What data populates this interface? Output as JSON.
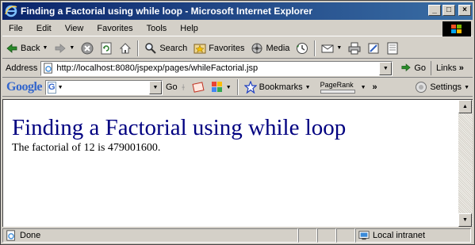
{
  "window": {
    "title": "Finding a Factorial using while loop - Microsoft Internet Explorer",
    "controls": {
      "minimize": "_",
      "maximize": "□",
      "close": "×"
    }
  },
  "menu": {
    "items": [
      "File",
      "Edit",
      "View",
      "Favorites",
      "Tools",
      "Help"
    ]
  },
  "toolbar": {
    "back_label": "Back",
    "search_label": "Search",
    "favorites_label": "Favorites",
    "media_label": "Media"
  },
  "address": {
    "label": "Address",
    "url": "http://localhost:8080/jspexp/pages/whileFactorial.jsp",
    "go_label": "Go",
    "links_label": "Links"
  },
  "google_toolbar": {
    "logo": "Google",
    "search_icon_letter": "G",
    "query": "",
    "go_label": "Go",
    "bookmarks_label": "Bookmarks",
    "pagerank_label": "PageRank",
    "settings_label": "Settings"
  },
  "page": {
    "heading": "Finding a Factorial using while loop",
    "result_text": "The factorial of 12 is 479001600."
  },
  "status": {
    "text": "Done",
    "zone": "Local intranet"
  },
  "colors": {
    "titlebar_start": "#0a246a",
    "titlebar_end": "#3a6ea5",
    "heading": "#000080",
    "chrome": "#d4d0c8"
  },
  "icons": [
    "ie-logo-icon",
    "windows-logo-icon",
    "back-arrow-icon",
    "forward-arrow-icon",
    "stop-icon",
    "refresh-icon",
    "home-icon",
    "search-icon",
    "favorites-icon",
    "media-icon",
    "history-icon",
    "mail-icon",
    "print-icon",
    "edit-icon",
    "discuss-icon",
    "page-icon",
    "go-arrow-icon",
    "star-icon",
    "settings-icon"
  ]
}
